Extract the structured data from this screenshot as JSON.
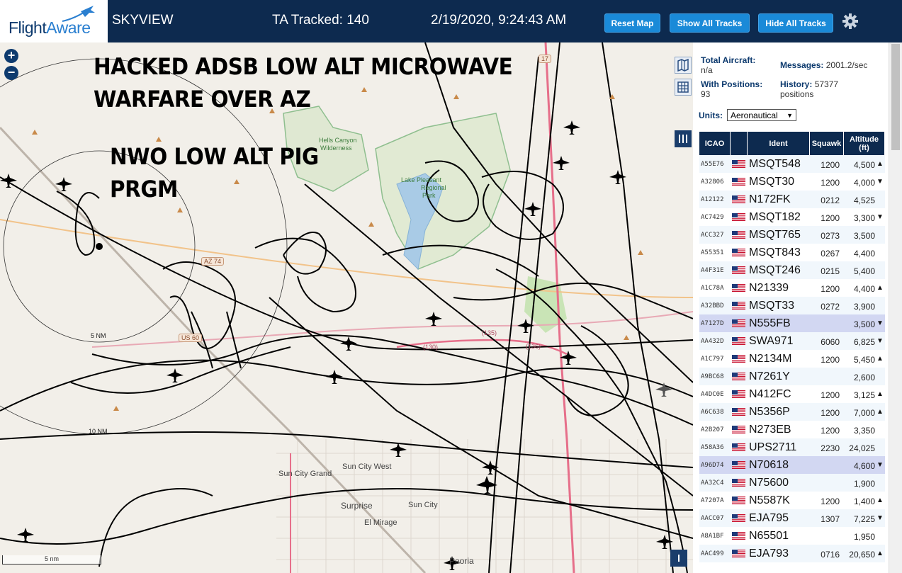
{
  "header": {
    "logo_text_a": "Flight",
    "logo_text_b": "Aware",
    "app_name": "SKYVIEW",
    "tracked": "TA Tracked: 140",
    "datetime": "2/19/2020, 9:24:43 AM",
    "btn_reset": "Reset Map",
    "btn_show": "Show All Tracks",
    "btn_hide": "Hide All Tracks"
  },
  "map": {
    "zoom_in": "+",
    "zoom_out": "−",
    "overlay_line1": "HACKED ADSB LOW ALT MICROWAVE",
    "overlay_line2": "WARFARE OVER AZ",
    "overlay_line3": "NWO LOW ALT PIG",
    "overlay_line4": "PRGM",
    "ring_5": "5 NM",
    "ring_10": "10 NM",
    "scale": "5 nm",
    "places": [
      "Hells Canyon",
      "Wilderness",
      "Lake Pleasant",
      "Regional",
      "Park",
      "Sun City Grand",
      "Sun City West",
      "Surprise",
      "Sun City",
      "El Mirage",
      "Peoria"
    ],
    "roads": [
      "AZ 74",
      "US 60",
      "(135)",
      "(136)",
      "(130)",
      "17"
    ]
  },
  "stats": {
    "total_label": "Total Aircraft:",
    "total_value": "n/a",
    "messages_label": "Messages:",
    "messages_value": "2001.2/sec",
    "positions_label": "With Positions:",
    "positions_value": "93",
    "history_label": "History:",
    "history_value": "57377",
    "history_unit": "positions",
    "units_label": "Units:",
    "units_value": "Aeronautical"
  },
  "table": {
    "headers": [
      "ICAO",
      "Ident",
      "Squawk",
      "Altitude (ft)"
    ],
    "rows": [
      {
        "icao": "A55E76",
        "ident": "MSQT548",
        "squawk": "1200",
        "alt": "4,500",
        "trend": "▲",
        "hl": false
      },
      {
        "icao": "A32806",
        "ident": "MSQT30",
        "squawk": "1200",
        "alt": "4,000",
        "trend": "▼",
        "hl": false
      },
      {
        "icao": "A12122",
        "ident": "N172FK",
        "squawk": "0212",
        "alt": "4,525",
        "trend": "",
        "hl": false
      },
      {
        "icao": "AC7429",
        "ident": "MSQT182",
        "squawk": "1200",
        "alt": "3,300",
        "trend": "▼",
        "hl": false
      },
      {
        "icao": "ACC327",
        "ident": "MSQT765",
        "squawk": "0273",
        "alt": "3,500",
        "trend": "",
        "hl": false
      },
      {
        "icao": "A55351",
        "ident": "MSQT843",
        "squawk": "0267",
        "alt": "4,400",
        "trend": "",
        "hl": false
      },
      {
        "icao": "A4F31E",
        "ident": "MSQT246",
        "squawk": "0215",
        "alt": "5,400",
        "trend": "",
        "hl": false
      },
      {
        "icao": "A1C78A",
        "ident": "N21339",
        "squawk": "1200",
        "alt": "4,400",
        "trend": "▲",
        "hl": false
      },
      {
        "icao": "A32BBD",
        "ident": "MSQT33",
        "squawk": "0272",
        "alt": "3,900",
        "trend": "",
        "hl": false
      },
      {
        "icao": "A7127D",
        "ident": "N555FB",
        "squawk": "",
        "alt": "3,500",
        "trend": "▼",
        "hl": true
      },
      {
        "icao": "AA432D",
        "ident": "SWA971",
        "squawk": "6060",
        "alt": "6,825",
        "trend": "▼",
        "hl": false
      },
      {
        "icao": "A1C797",
        "ident": "N2134M",
        "squawk": "1200",
        "alt": "5,450",
        "trend": "▲",
        "hl": false
      },
      {
        "icao": "A9BC68",
        "ident": "N7261Y",
        "squawk": "",
        "alt": "2,600",
        "trend": "",
        "hl": false
      },
      {
        "icao": "A4DC0E",
        "ident": "N412FC",
        "squawk": "1200",
        "alt": "3,125",
        "trend": "▲",
        "hl": false
      },
      {
        "icao": "A6C638",
        "ident": "N5356P",
        "squawk": "1200",
        "alt": "7,000",
        "trend": "▲",
        "hl": false
      },
      {
        "icao": "A2B207",
        "ident": "N273EB",
        "squawk": "1200",
        "alt": "3,350",
        "trend": "",
        "hl": false
      },
      {
        "icao": "A58A36",
        "ident": "UPS2711",
        "squawk": "2230",
        "alt": "24,025",
        "trend": "",
        "hl": false
      },
      {
        "icao": "A96D74",
        "ident": "N70618",
        "squawk": "",
        "alt": "4,600",
        "trend": "▼",
        "hl": true
      },
      {
        "icao": "AA32C4",
        "ident": "N75600",
        "squawk": "",
        "alt": "1,900",
        "trend": "",
        "hl": false
      },
      {
        "icao": "A7207A",
        "ident": "N5587K",
        "squawk": "1200",
        "alt": "1,400",
        "trend": "▲",
        "hl": false
      },
      {
        "icao": "AACC07",
        "ident": "EJA795",
        "squawk": "1307",
        "alt": "7,225",
        "trend": "▼",
        "hl": false
      },
      {
        "icao": "A8A1BF",
        "ident": "N65501",
        "squawk": "",
        "alt": "1,950",
        "trend": "",
        "hl": false
      },
      {
        "icao": "AAC499",
        "ident": "EJA793",
        "squawk": "0716",
        "alt": "20,650",
        "trend": "▲",
        "hl": false
      }
    ]
  },
  "colors": {
    "topbar": "#0d2a4f",
    "button": "#1a8ad8",
    "row_highlight": "#d2d7f2",
    "park": "#7fb98a"
  }
}
